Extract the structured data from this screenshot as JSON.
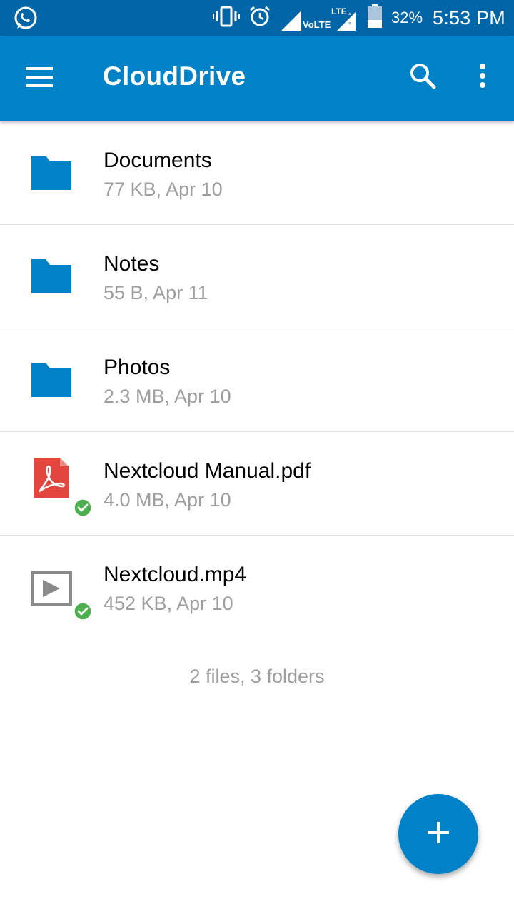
{
  "status_bar": {
    "battery_percent": "32%",
    "time": "5:53 PM",
    "network_label": "VoLTE",
    "network_type": "LTE",
    "icons": [
      "whatsapp-icon",
      "vibrate-icon",
      "alarm-icon",
      "signal-icon",
      "battery-icon"
    ]
  },
  "app_bar": {
    "title": "CloudDrive",
    "menu_icon": "hamburger-menu-icon",
    "search_icon": "search-icon",
    "more_icon": "more-vertical-icon"
  },
  "files": [
    {
      "name": "Documents",
      "meta": "77 KB, Apr 10",
      "type": "folder",
      "synced": false
    },
    {
      "name": "Notes",
      "meta": "55 B, Apr 11",
      "type": "folder",
      "synced": false
    },
    {
      "name": "Photos",
      "meta": "2.3 MB, Apr 10",
      "type": "folder",
      "synced": false
    },
    {
      "name": "Nextcloud Manual.pdf",
      "meta": "4.0 MB, Apr 10",
      "type": "pdf",
      "synced": true
    },
    {
      "name": "Nextcloud.mp4",
      "meta": "452 KB, Apr 10",
      "type": "video",
      "synced": true
    }
  ],
  "summary": "2 files, 3 folders",
  "fab": {
    "icon": "plus-icon"
  },
  "colors": {
    "status_bar": "#0066a8",
    "app_bar": "#0082c9",
    "folder": "#0082c9",
    "pdf": "#e2463f",
    "sync_ok": "#4caf50",
    "meta_text": "#9e9e9e"
  }
}
